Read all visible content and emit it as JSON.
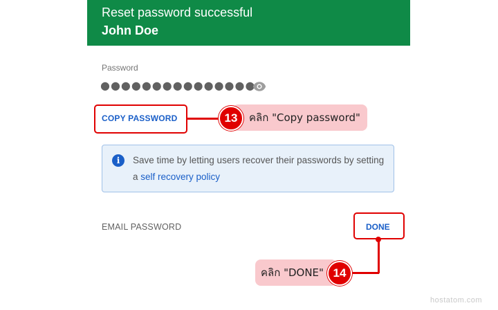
{
  "header": {
    "title": "Reset password successful",
    "user_name": "John Doe"
  },
  "password": {
    "label": "Password",
    "masked_value": "●●●●●●●●●●●●●●●●",
    "reveal_icon": "eye-icon"
  },
  "actions": {
    "copy_password_label": "COPY PASSWORD",
    "email_password_label": "EMAIL PASSWORD",
    "done_label": "DONE"
  },
  "info": {
    "icon": "info-icon",
    "icon_glyph": "i",
    "text_prefix": "Save time by letting users recover their passwords by setting a ",
    "link_text": "self recovery policy"
  },
  "annotations": {
    "step13": {
      "number": "13",
      "label": "คลิก \"Copy password\""
    },
    "step14": {
      "number": "14",
      "label": "คลิก \"DONE\""
    }
  },
  "watermark": "hostatom.com",
  "colors": {
    "header_bg": "#0f8a47",
    "accent_blue": "#1a5fc8",
    "annotation_red": "#e00000",
    "annotation_label_bg": "#f9c9cd",
    "info_bg": "#e8f1fa"
  }
}
